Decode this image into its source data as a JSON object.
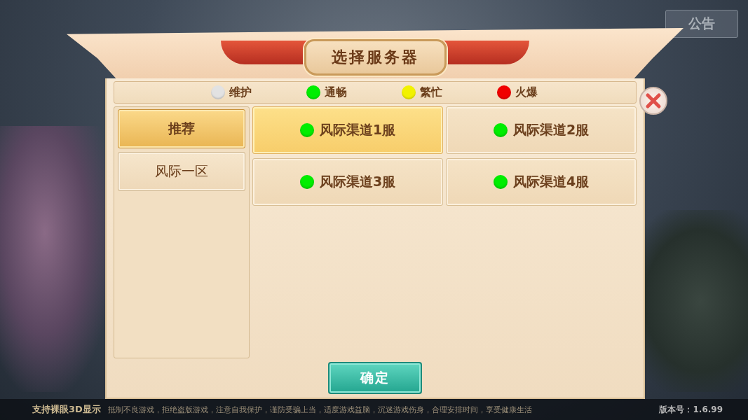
{
  "announcement_button": "公告",
  "title": "选择服务器",
  "legend": [
    {
      "label": "维护",
      "color": "#e2e2e2"
    },
    {
      "label": "通畅",
      "color": "#00ee00"
    },
    {
      "label": "繁忙",
      "color": "#f2f200"
    },
    {
      "label": "火爆",
      "color": "#f00000"
    }
  ],
  "zones": [
    {
      "label": "推荐",
      "selected": true
    },
    {
      "label": "风际一区",
      "selected": false
    }
  ],
  "servers": [
    {
      "name": "风际渠道1服",
      "color": "#00ee00",
      "selected": true
    },
    {
      "name": "风际渠道2服",
      "color": "#00ee00",
      "selected": false
    },
    {
      "name": "风际渠道3服",
      "color": "#00ee00",
      "selected": false
    },
    {
      "name": "风际渠道4服",
      "color": "#00ee00",
      "selected": false
    }
  ],
  "confirm_button": "确定",
  "footer": {
    "feature": "支持裸眼3D显示",
    "notice": "抵制不良游戏，拒绝盗版游戏，注意自我保护，谨防受骗上当，适度游戏益脑，沉迷游戏伤身，合理安排时间，享受健康生活",
    "version": "版本号：1.6.99"
  }
}
